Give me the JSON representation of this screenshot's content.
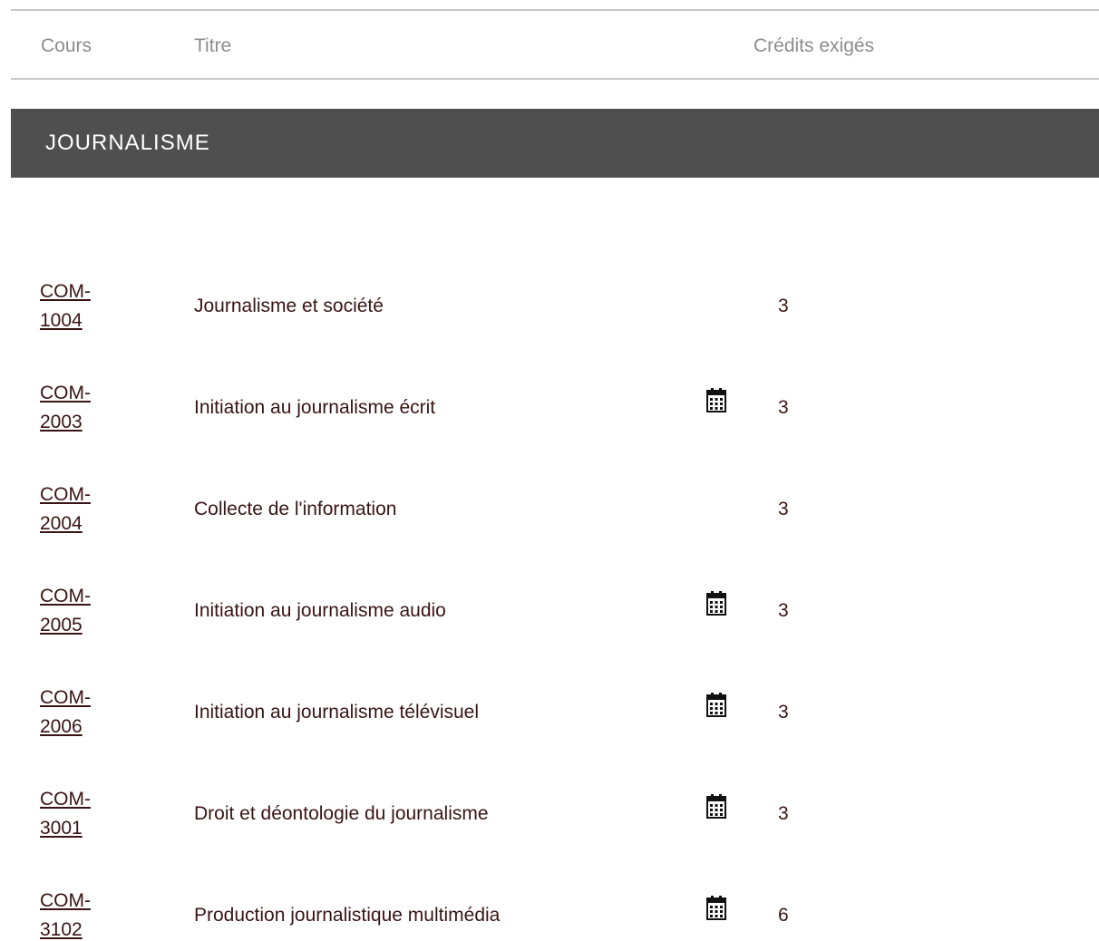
{
  "table_header": {
    "cours": "Cours",
    "titre": "Titre",
    "credits": "Crédits exigés"
  },
  "section": {
    "title": "JOURNALISME"
  },
  "courses": [
    {
      "code_prefix": "COM-",
      "code_number": "1004",
      "title": "Journalisme et société",
      "credits": "3",
      "schedule_icon": false
    },
    {
      "code_prefix": "COM-",
      "code_number": "2003",
      "title": "Initiation au journalisme écrit",
      "credits": "3",
      "schedule_icon": true
    },
    {
      "code_prefix": "COM-",
      "code_number": "2004",
      "title": "Collecte de l'information",
      "credits": "3",
      "schedule_icon": false
    },
    {
      "code_prefix": "COM-",
      "code_number": "2005",
      "title": "Initiation au journalisme audio",
      "credits": "3",
      "schedule_icon": true
    },
    {
      "code_prefix": "COM-",
      "code_number": "2006",
      "title": "Initiation au journalisme télévisuel",
      "credits": "3",
      "schedule_icon": true
    },
    {
      "code_prefix": "COM-",
      "code_number": "3001",
      "title": "Droit et déontologie du journalisme",
      "credits": "3",
      "schedule_icon": true
    },
    {
      "code_prefix": "COM-",
      "code_number": "3102",
      "title": "Production journalistique multimédia",
      "credits": "6",
      "schedule_icon": true
    }
  ],
  "icon_names": {
    "schedule": "calendar-icon"
  },
  "colors": {
    "section_bar": "#4f4f4f",
    "header_text": "#8c8c8c",
    "body_text": "#3a1414",
    "rule": "#c8c8c8"
  }
}
